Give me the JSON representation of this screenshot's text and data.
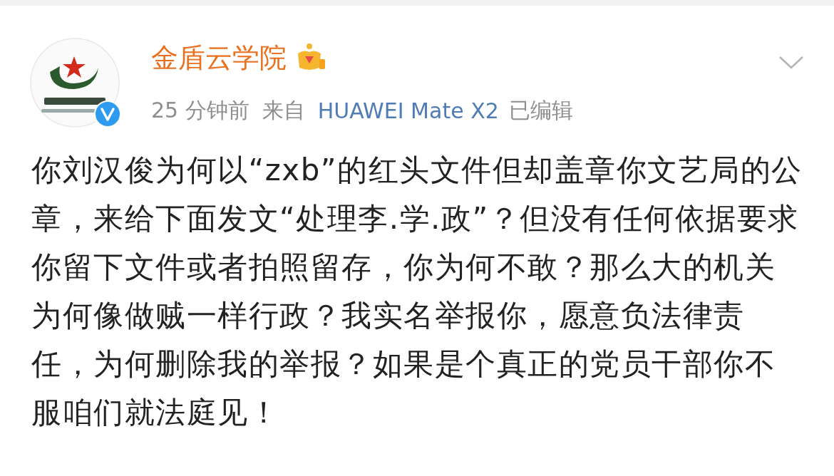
{
  "post": {
    "author": {
      "name": "金盾云学院",
      "verified": true
    },
    "meta": {
      "time": "25 分钟前",
      "source_prefix": "来自",
      "device": "HUAWEI Mate X2",
      "edited": "已编辑"
    },
    "text": "你刘汉俊为何以“zxb”的红头文件但却盖章你文艺局的公章，来给下面发文“处理李.学.政”？但没有任何依据要求你留下文件或者拍照留存，你为何不敢？那么大的机关为何像做贼一样行政？我实名举报你，愿意负法律责任，为何删除我的举报？如果是个真正的党员干部你不服咱们就法庭见！"
  }
}
